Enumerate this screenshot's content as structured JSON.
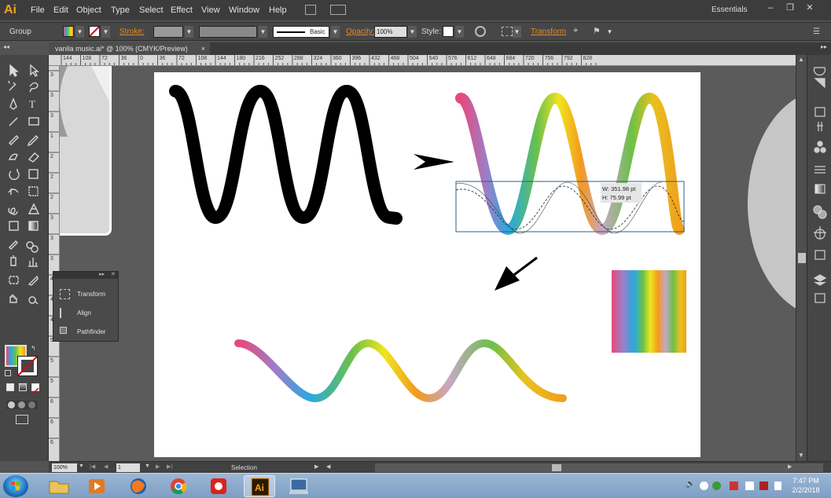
{
  "app": {
    "logo": "Ai",
    "menus": [
      "File",
      "Edit",
      "Object",
      "Type",
      "Select",
      "Effect",
      "View",
      "Window",
      "Help"
    ],
    "workspace": "Essentials",
    "window_controls": [
      "–",
      "❐",
      "✕"
    ]
  },
  "control_bar": {
    "selection_type": "Group",
    "stroke_label": "Stroke:",
    "stroke_style": "Basic",
    "opacity_label": "Opacity:",
    "opacity_value": "100%",
    "style_label": "Style:",
    "transform_label": "Transform"
  },
  "document": {
    "tab_title": "vanila music.ai* @ 100% (CMYK/Preview)",
    "close": "×",
    "selection_tooltip": {
      "width": "W: 351.98 pt",
      "height": "H: 75.99 pt"
    }
  },
  "ruler": {
    "h_labels": [
      "144",
      "108",
      "72",
      "36",
      "0",
      "36",
      "72",
      "108",
      "144",
      "180",
      "216",
      "252",
      "288",
      "324",
      "360",
      "396",
      "432",
      "468",
      "504",
      "540",
      "576",
      "612",
      "648",
      "684",
      "720",
      "756",
      "792",
      "828"
    ],
    "v_labels": [
      "3",
      "3",
      "3",
      "1",
      "2",
      "2",
      "2",
      "3",
      "3",
      "3",
      "4",
      "4",
      "4",
      "5",
      "5",
      "5",
      "6",
      "6",
      "6"
    ]
  },
  "float_panel": {
    "items": [
      {
        "label": "Transform"
      },
      {
        "label": "Align"
      },
      {
        "label": "Pathfinder"
      }
    ]
  },
  "status_bar": {
    "zoom": "100%",
    "artboard": "1",
    "status_text": "Selection"
  },
  "taskbar": {
    "time": "7:47 PM",
    "date": "2/2/2018"
  },
  "colors": {
    "gradient": [
      "#e8497a",
      "#9b7fc9",
      "#28a9e0",
      "#6cc04a",
      "#f0e51e",
      "#f39a1e",
      "#c6a8c4",
      "#e8c21e",
      "#f0a01e"
    ],
    "accent": "#e8891c"
  }
}
